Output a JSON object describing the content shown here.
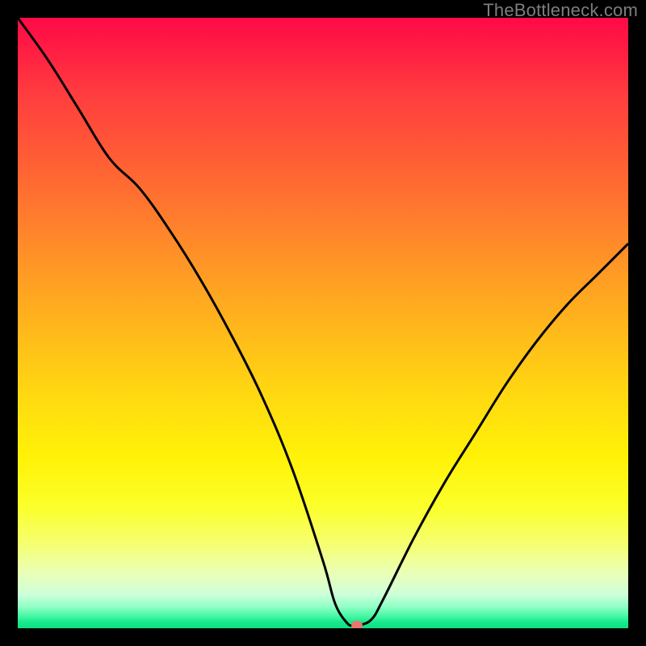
{
  "watermark": "TheBottleneck.com",
  "colors": {
    "frame_border": "#000000",
    "curve_stroke": "#000000",
    "marker_fill": "#e8766f",
    "gradient_top": "#ff0a46",
    "gradient_bottom": "#0ee085"
  },
  "chart_data": {
    "type": "line",
    "title": "",
    "xlabel": "",
    "ylabel": "",
    "xlim": [
      0,
      100
    ],
    "ylim": [
      0,
      100
    ],
    "x": [
      0,
      5,
      10,
      15,
      20,
      25,
      30,
      35,
      40,
      45,
      50,
      52,
      54,
      55,
      56,
      58,
      60,
      65,
      70,
      75,
      80,
      85,
      90,
      95,
      100
    ],
    "values": [
      100,
      93,
      85,
      77,
      72,
      65,
      57,
      48,
      38,
      26,
      11,
      4,
      0.8,
      0.5,
      0.5,
      1.5,
      5,
      15,
      24,
      32,
      40,
      47,
      53,
      58,
      63
    ],
    "marker": {
      "x": 55.5,
      "y": 0.5
    },
    "note": "x and y expressed as percentage of plot area; y=0 at bottom, y=100 at top"
  }
}
